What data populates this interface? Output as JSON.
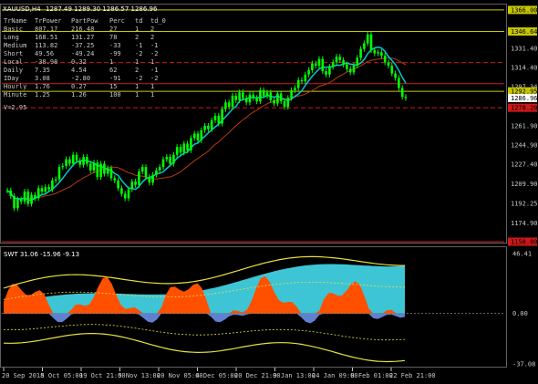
{
  "header": {
    "symbol": "XAUUSD,H4",
    "ohlc": "1287.49 1289.30 1286.57 1286.96"
  },
  "info_table": {
    "columns": [
      "TrName",
      "TrPower",
      "PartPow",
      "Perc",
      "td",
      "td_0"
    ],
    "rows": [
      [
        "Basic",
        "807.17",
        "216.48",
        "27",
        "1",
        "2"
      ],
      [
        "Long",
        "168.51",
        "131.27",
        "78",
        "2",
        "2"
      ],
      [
        "Medium",
        "113.82",
        "-37.25",
        "-33",
        "-1",
        "-1"
      ],
      [
        "Short",
        "49.56",
        "-49.24",
        "-99",
        "-2",
        "-2"
      ],
      [
        "Local",
        "-38.98",
        "0.32",
        "1",
        "1",
        "1"
      ],
      [
        "Daily",
        "7.35",
        "4.54",
        "62",
        "2",
        "-1"
      ],
      [
        "IDay",
        "3.08",
        "-2.80",
        "-91",
        "-2",
        "-2"
      ],
      [
        "Hourly",
        "1.76",
        "0.27",
        "15",
        "1",
        "1"
      ],
      [
        "Minute",
        "1.25",
        "1.26",
        "100",
        "1",
        "1"
      ]
    ],
    "footer": "V=2.95"
  },
  "price_axis": {
    "ticks": [
      "1366.00",
      "1346.64",
      "1331.40",
      "1314.40",
      "1297.34",
      "1292.95",
      "1286.96",
      "1278.20",
      "1261.90",
      "1244.90",
      "1227.40",
      "1209.90",
      "1192.25",
      "1174.90",
      "1158.00"
    ]
  },
  "oscillator": {
    "label": "SWT 31.06 -15.96 -9.13",
    "axis_ticks": [
      "46.41",
      "0.00",
      "-37.08"
    ]
  },
  "time_axis": {
    "labels": [
      "20 Sep 2018",
      "5 Oct 05:00",
      "19 Oct 21:00",
      "5 Nov 13:00",
      "20 Nov 05:00",
      "4 Dec 05:00",
      "20 Dec 21:00",
      "9 Jan 13:00",
      "24 Jan 09:00",
      "8 Feb 01:00",
      "22 Feb 21:00"
    ]
  },
  "colors": {
    "background": "#000000",
    "candles": "#00ff00",
    "ma_cyan": "#00c8d8",
    "ma_brown": "#b83a10",
    "level_red": "#d01818",
    "level_yellow": "#c8c800",
    "osc_orange": "#ff5000",
    "osc_cyan": "#40d0e0",
    "osc_blue": "#6080d0",
    "band_yellow": "#e8e040",
    "axis_fg": "#c8c8c8"
  },
  "chart_data": {
    "type": "candlestick",
    "symbol": "XAUUSD",
    "timeframe": "H4",
    "ylim": [
      1158,
      1370
    ],
    "x_labels": [
      "20 Sep 2018",
      "5 Oct 05:00",
      "19 Oct 21:00",
      "5 Nov 13:00",
      "20 Nov 05:00",
      "4 Dec 05:00",
      "20 Dec 21:00",
      "9 Jan 13:00",
      "24 Jan 09:00",
      "8 Feb 01:00",
      "22 Feb 21:00"
    ],
    "close_series": [
      1204,
      1199,
      1188,
      1196,
      1194,
      1203,
      1192,
      1200,
      1197,
      1206,
      1203,
      1207,
      1205,
      1213,
      1214,
      1225,
      1226,
      1232,
      1228,
      1236,
      1231,
      1227,
      1234,
      1228,
      1222,
      1229,
      1216,
      1228,
      1219,
      1224,
      1215,
      1213,
      1206,
      1201,
      1197,
      1205,
      1212,
      1209,
      1221,
      1225,
      1216,
      1211,
      1218,
      1222,
      1225,
      1232,
      1234,
      1228,
      1236,
      1243,
      1238,
      1246,
      1240,
      1251,
      1255,
      1249,
      1258,
      1262,
      1259,
      1267,
      1271,
      1264,
      1277,
      1283,
      1279,
      1289,
      1285,
      1292,
      1287,
      1283,
      1290,
      1287,
      1284,
      1294,
      1289,
      1292,
      1285,
      1282,
      1291,
      1284,
      1279,
      1287,
      1294,
      1296,
      1303,
      1302,
      1308,
      1312,
      1318,
      1316,
      1322,
      1311,
      1308,
      1315,
      1319,
      1324,
      1321,
      1317,
      1313,
      1310,
      1316,
      1323,
      1331,
      1336,
      1344,
      1330,
      1327,
      1328,
      1325,
      1319,
      1316,
      1309,
      1305,
      1296,
      1288,
      1287
    ],
    "levels": [
      {
        "value": 1366.0,
        "color": "yellow"
      },
      {
        "value": 1346.64,
        "color": "yellow"
      },
      {
        "value": 1318.74,
        "color": "red",
        "style": "dashed"
      },
      {
        "value": 1299.81,
        "color": "red"
      },
      {
        "value": 1292.95,
        "color": "yellow"
      },
      {
        "value": 1278.2,
        "color": "red",
        "style": "dashed"
      },
      {
        "value": 1158.0,
        "color": "red"
      }
    ],
    "current_price": 1286.96,
    "oscillator": {
      "name": "SWT",
      "values": [
        31.06,
        -15.96,
        -9.13
      ],
      "ylim": [
        -37.08,
        46.41
      ]
    }
  }
}
